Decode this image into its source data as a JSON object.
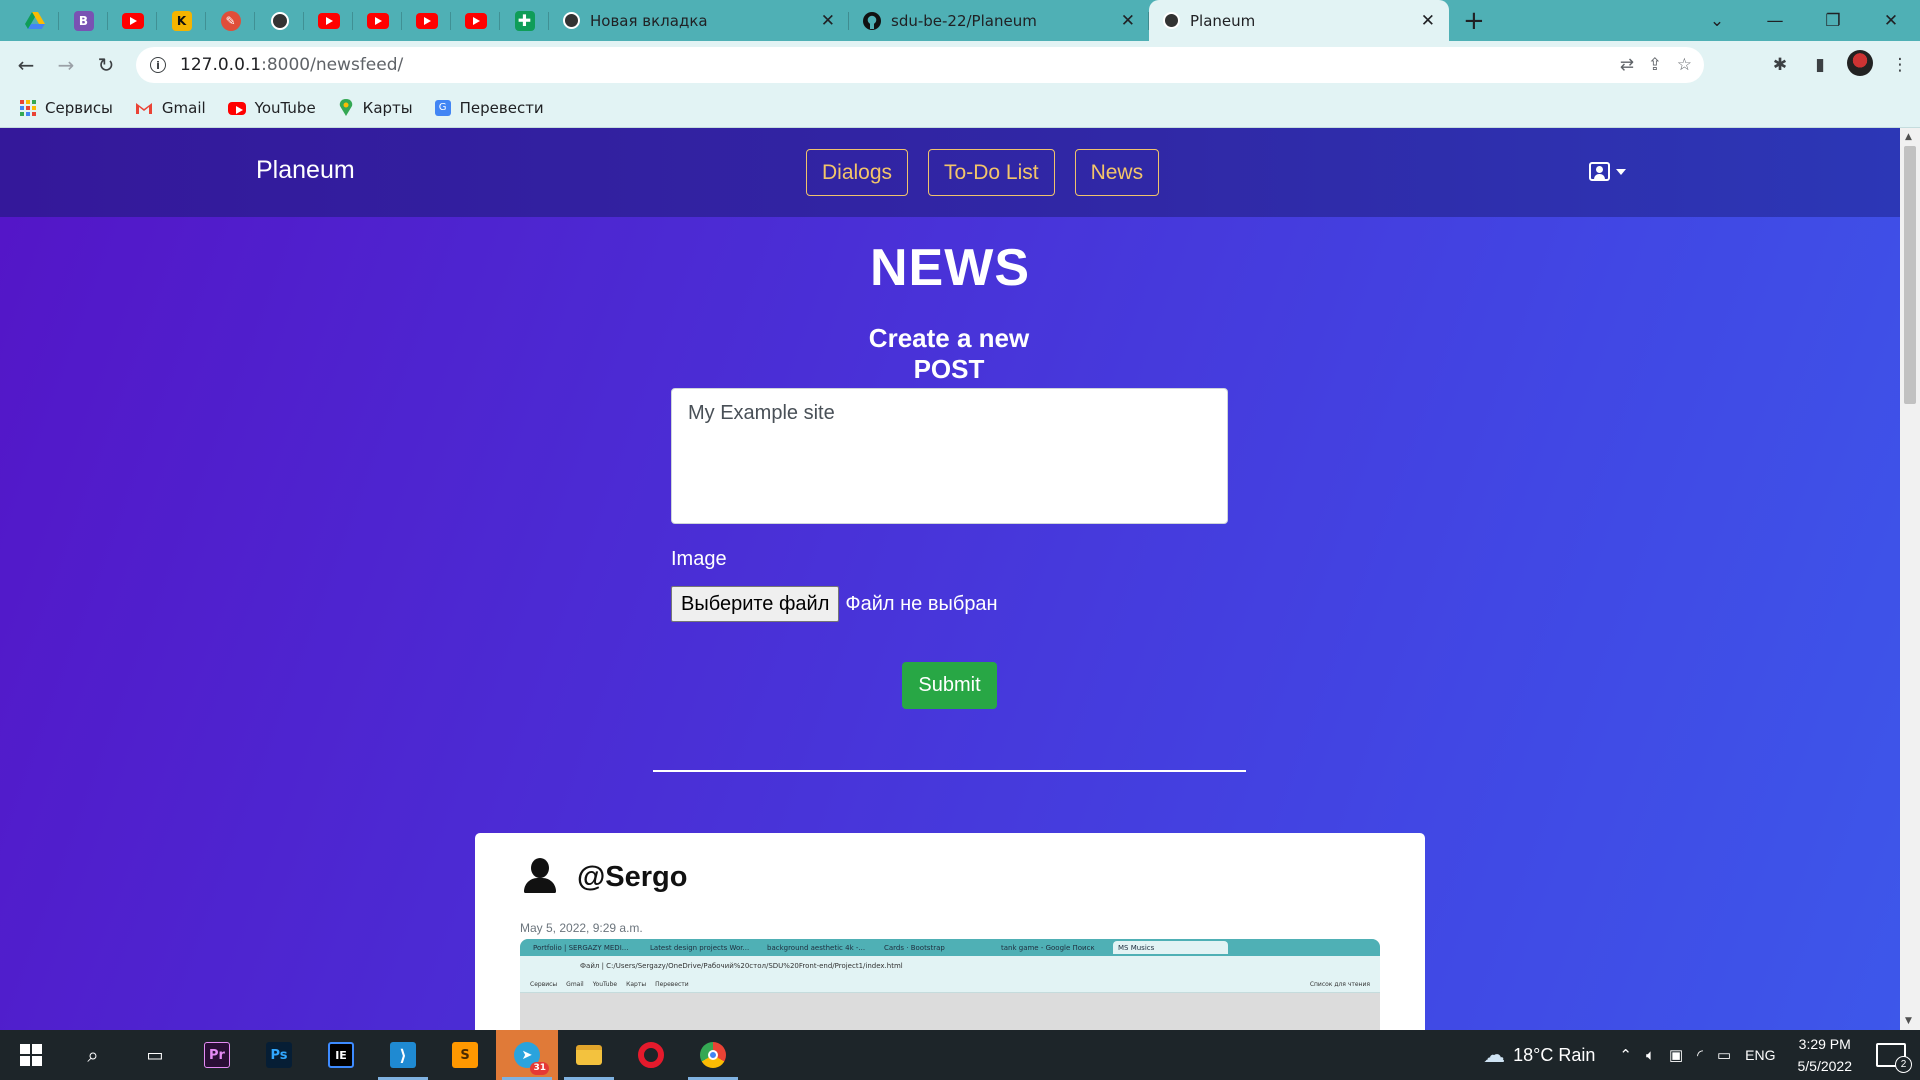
{
  "browser": {
    "pinned_tabs": [
      {
        "icon": "google-drive-icon",
        "color": "#34a853"
      },
      {
        "icon": "bootstrap-icon",
        "letter": "B",
        "color": "#7952b3"
      },
      {
        "icon": "youtube-icon",
        "color": "#ff0000"
      },
      {
        "icon": "kinopoisk-icon",
        "letter": "K",
        "color": "#f5b400"
      },
      {
        "icon": "photoshop-tool-icon",
        "color": "#e04e39"
      },
      {
        "icon": "globe-icon",
        "color": "#333333"
      },
      {
        "icon": "youtube-icon",
        "color": "#ff0000"
      },
      {
        "icon": "youtube-icon",
        "color": "#ff0000"
      },
      {
        "icon": "youtube-icon",
        "color": "#ff0000"
      },
      {
        "icon": "youtube-icon",
        "color": "#ff0000"
      },
      {
        "icon": "google-sheets-icon",
        "color": "#0f9d58"
      }
    ],
    "tabs": [
      {
        "title": "Новая вкладка",
        "icon": "chrome-icon",
        "active": false
      },
      {
        "title": "sdu-be-22/Planeum",
        "icon": "github-icon",
        "active": false
      },
      {
        "title": "Planeum",
        "icon": "globe-icon",
        "active": true
      }
    ],
    "url_host": "127.0.0.1",
    "url_path": ":8000/newsfeed/",
    "bookmarks": [
      {
        "label": "Сервисы",
        "icon": "apps-grid-icon"
      },
      {
        "label": "Gmail",
        "icon": "gmail-icon"
      },
      {
        "label": "YouTube",
        "icon": "youtube-icon"
      },
      {
        "label": "Карты",
        "icon": "maps-icon"
      },
      {
        "label": "Перевести",
        "icon": "translate-icon"
      }
    ]
  },
  "site": {
    "brand": "Planeum",
    "nav": [
      "Dialogs",
      "To-Do List",
      "News"
    ],
    "accent_color": "#f3c569"
  },
  "main": {
    "heading": "NEWS",
    "subheading": "Create a new POST",
    "post_text": "My Example site",
    "image_label": "Image",
    "file_button": "Выберите файл",
    "file_status": "Файл не выбран",
    "submit_label": "Submit",
    "submit_color": "#28a745"
  },
  "post": {
    "author": "@Sergo",
    "date": "May 5, 2022, 9:29 a.m.",
    "screenshot": {
      "tabs": [
        "Portfolio | SERGAZY MEDI...",
        "Latest design projects Wor...",
        "background aesthetic 4k -...",
        "Cards · Bootstrap",
        "tank game - Google Поиск",
        "MS Musics"
      ],
      "url": "Файл | C:/Users/Sergazy/OneDrive/Рабочий%20стол/SDU%20Front-end/Project1/index.html",
      "bookmarks": [
        "Сервисы",
        "Gmail",
        "YouTube",
        "Карты",
        "Перевести"
      ],
      "reading_list": "Список для чтения"
    }
  },
  "taskbar": {
    "apps": [
      "windows-start-icon",
      "search-icon",
      "task-view-icon",
      "premiere-pro-icon",
      "photoshop-icon",
      "intellij-icon",
      "vscode-icon",
      "sublime-text-icon",
      "telegram-icon",
      "file-explorer-icon",
      "opera-icon",
      "chrome-icon"
    ],
    "telegram_badge": "31",
    "weather": "18°C  Rain",
    "lang": "ENG",
    "time": "3:29 PM",
    "date": "5/5/2022",
    "notifications": "2"
  }
}
